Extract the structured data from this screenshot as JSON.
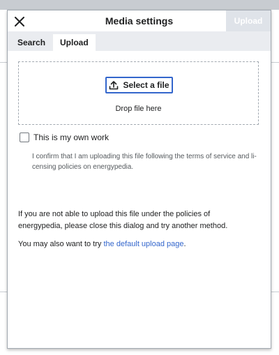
{
  "dialog": {
    "title": "Media settings",
    "primary_button": "Upload",
    "tabs": [
      {
        "label": "Search",
        "active": false
      },
      {
        "label": "Upload",
        "active": true
      }
    ]
  },
  "upload": {
    "select_file_label": "Select a file",
    "drop_text": "Drop file here",
    "own_work_label": "This is my own work",
    "own_work_checked": false,
    "confirm_text": "I confirm that I am uploading this file following the terms of service and li-censing policies on energypedia.",
    "notice_text": "If you are not able to upload this file under the policies of energypedia, please close this dialog and try another method.",
    "also_prefix": "You may also want to try ",
    "also_link": "the default upload page",
    "also_suffix": "."
  },
  "colors": {
    "accent": "#3366cc",
    "disabled_button": "#dfe3e9"
  },
  "icons": {
    "close": "close-icon",
    "upload": "upload-icon"
  }
}
